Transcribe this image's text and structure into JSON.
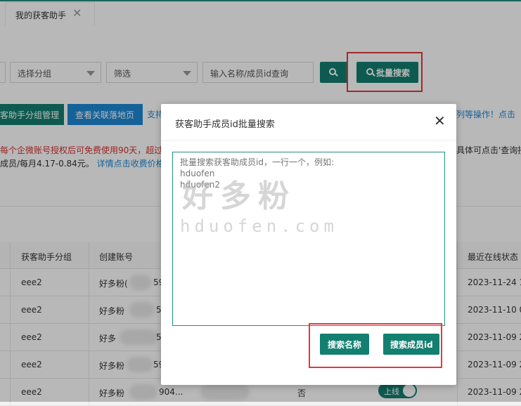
{
  "tab": {
    "label": "我的获客助手",
    "close": "✕"
  },
  "filters": {
    "group_select": "选择分组",
    "filter_select": "筛选",
    "search_placeholder": "输入名称/成员id查询",
    "bulk_search_label": "批量搜索"
  },
  "actions": {
    "group_manage": "客助手分组管理",
    "view_landing": "查看关联落地页",
    "support_link": "支持",
    "right_link": "列等操作！点击"
  },
  "notice": {
    "line1": "每个企微账号授权后可免费使用90天，超过",
    "line2_prefix": "成员/每月4.17-0.84元。",
    "line2_link": "详情点击收费价格查",
    "right": "具体可点击'查询接"
  },
  "table": {
    "headers": [
      "获客助手分组",
      "创建账号",
      "最近在线状态"
    ],
    "rows": [
      {
        "group": "eee2",
        "creator": "好多粉(",
        "creator_suffix": "59",
        "date": "2023-11-24 17"
      },
      {
        "group": "eee2",
        "creator": "好多粉",
        "creator_suffix": "59",
        "date": "2023-11-10 00"
      },
      {
        "group": "eee2",
        "creator": "好多",
        "creator_suffix": "59",
        "date": "2023-11-09 23"
      },
      {
        "group": "eee2",
        "creator": "好多粉",
        "creator_suffix": "59",
        "date": "2023-11-09 23"
      },
      {
        "group": "eee2",
        "creator": "好多粉",
        "creator_suffix": "904...",
        "status": "否",
        "toggle": "上线",
        "date": "2023-11-09 23"
      }
    ]
  },
  "modal": {
    "title": "获客助手成员id批量搜索",
    "textarea_placeholder": "批量搜索获客助成员id，一行一个，例如:\nhduofen\nhduofen2",
    "btn_search_name": "搜索名称",
    "btn_search_id": "搜索成员id"
  },
  "watermark": {
    "brand": "好多粉",
    "domain": "hduofen.com"
  },
  "colors": {
    "primary": "#127f70",
    "link": "#1e88d4",
    "highlight": "#e03a3a"
  }
}
